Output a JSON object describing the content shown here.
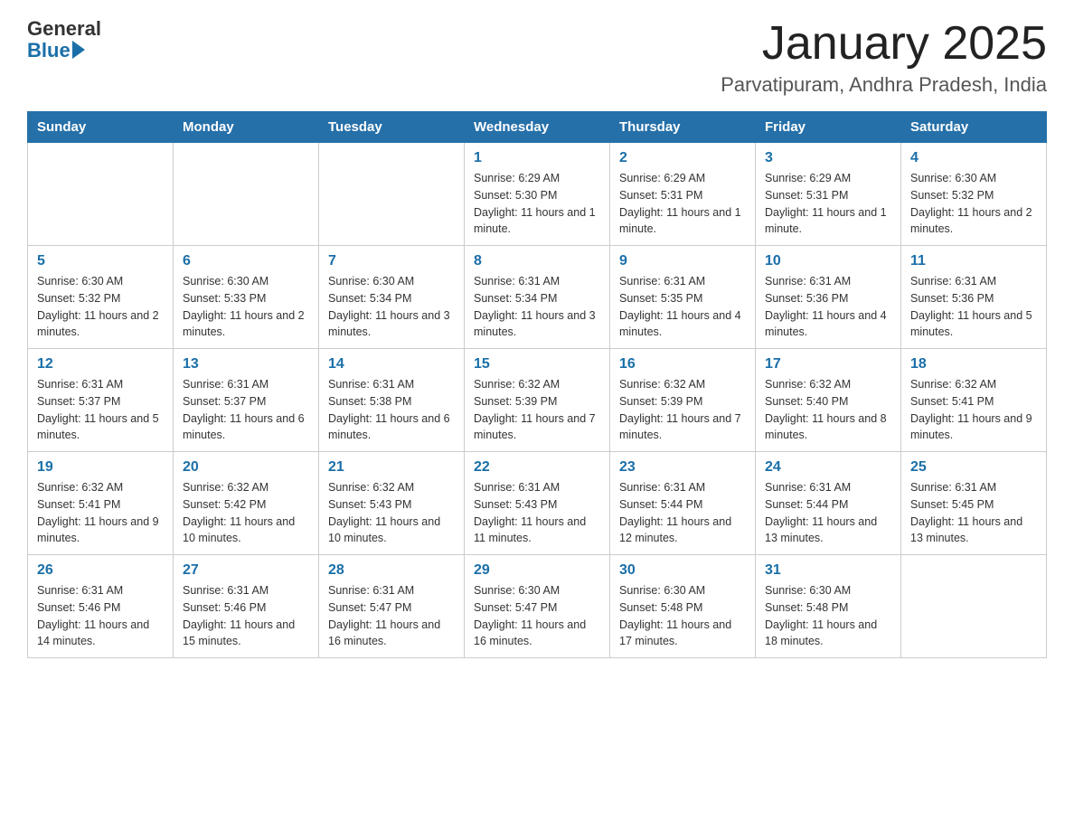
{
  "header": {
    "logo_general": "General",
    "logo_blue": "Blue",
    "month_year": "January 2025",
    "location": "Parvatipuram, Andhra Pradesh, India"
  },
  "weekdays": [
    "Sunday",
    "Monday",
    "Tuesday",
    "Wednesday",
    "Thursday",
    "Friday",
    "Saturday"
  ],
  "weeks": [
    [
      {
        "day": "",
        "info": ""
      },
      {
        "day": "",
        "info": ""
      },
      {
        "day": "",
        "info": ""
      },
      {
        "day": "1",
        "info": "Sunrise: 6:29 AM\nSunset: 5:30 PM\nDaylight: 11 hours and 1 minute."
      },
      {
        "day": "2",
        "info": "Sunrise: 6:29 AM\nSunset: 5:31 PM\nDaylight: 11 hours and 1 minute."
      },
      {
        "day": "3",
        "info": "Sunrise: 6:29 AM\nSunset: 5:31 PM\nDaylight: 11 hours and 1 minute."
      },
      {
        "day": "4",
        "info": "Sunrise: 6:30 AM\nSunset: 5:32 PM\nDaylight: 11 hours and 2 minutes."
      }
    ],
    [
      {
        "day": "5",
        "info": "Sunrise: 6:30 AM\nSunset: 5:32 PM\nDaylight: 11 hours and 2 minutes."
      },
      {
        "day": "6",
        "info": "Sunrise: 6:30 AM\nSunset: 5:33 PM\nDaylight: 11 hours and 2 minutes."
      },
      {
        "day": "7",
        "info": "Sunrise: 6:30 AM\nSunset: 5:34 PM\nDaylight: 11 hours and 3 minutes."
      },
      {
        "day": "8",
        "info": "Sunrise: 6:31 AM\nSunset: 5:34 PM\nDaylight: 11 hours and 3 minutes."
      },
      {
        "day": "9",
        "info": "Sunrise: 6:31 AM\nSunset: 5:35 PM\nDaylight: 11 hours and 4 minutes."
      },
      {
        "day": "10",
        "info": "Sunrise: 6:31 AM\nSunset: 5:36 PM\nDaylight: 11 hours and 4 minutes."
      },
      {
        "day": "11",
        "info": "Sunrise: 6:31 AM\nSunset: 5:36 PM\nDaylight: 11 hours and 5 minutes."
      }
    ],
    [
      {
        "day": "12",
        "info": "Sunrise: 6:31 AM\nSunset: 5:37 PM\nDaylight: 11 hours and 5 minutes."
      },
      {
        "day": "13",
        "info": "Sunrise: 6:31 AM\nSunset: 5:37 PM\nDaylight: 11 hours and 6 minutes."
      },
      {
        "day": "14",
        "info": "Sunrise: 6:31 AM\nSunset: 5:38 PM\nDaylight: 11 hours and 6 minutes."
      },
      {
        "day": "15",
        "info": "Sunrise: 6:32 AM\nSunset: 5:39 PM\nDaylight: 11 hours and 7 minutes."
      },
      {
        "day": "16",
        "info": "Sunrise: 6:32 AM\nSunset: 5:39 PM\nDaylight: 11 hours and 7 minutes."
      },
      {
        "day": "17",
        "info": "Sunrise: 6:32 AM\nSunset: 5:40 PM\nDaylight: 11 hours and 8 minutes."
      },
      {
        "day": "18",
        "info": "Sunrise: 6:32 AM\nSunset: 5:41 PM\nDaylight: 11 hours and 9 minutes."
      }
    ],
    [
      {
        "day": "19",
        "info": "Sunrise: 6:32 AM\nSunset: 5:41 PM\nDaylight: 11 hours and 9 minutes."
      },
      {
        "day": "20",
        "info": "Sunrise: 6:32 AM\nSunset: 5:42 PM\nDaylight: 11 hours and 10 minutes."
      },
      {
        "day": "21",
        "info": "Sunrise: 6:32 AM\nSunset: 5:43 PM\nDaylight: 11 hours and 10 minutes."
      },
      {
        "day": "22",
        "info": "Sunrise: 6:31 AM\nSunset: 5:43 PM\nDaylight: 11 hours and 11 minutes."
      },
      {
        "day": "23",
        "info": "Sunrise: 6:31 AM\nSunset: 5:44 PM\nDaylight: 11 hours and 12 minutes."
      },
      {
        "day": "24",
        "info": "Sunrise: 6:31 AM\nSunset: 5:44 PM\nDaylight: 11 hours and 13 minutes."
      },
      {
        "day": "25",
        "info": "Sunrise: 6:31 AM\nSunset: 5:45 PM\nDaylight: 11 hours and 13 minutes."
      }
    ],
    [
      {
        "day": "26",
        "info": "Sunrise: 6:31 AM\nSunset: 5:46 PM\nDaylight: 11 hours and 14 minutes."
      },
      {
        "day": "27",
        "info": "Sunrise: 6:31 AM\nSunset: 5:46 PM\nDaylight: 11 hours and 15 minutes."
      },
      {
        "day": "28",
        "info": "Sunrise: 6:31 AM\nSunset: 5:47 PM\nDaylight: 11 hours and 16 minutes."
      },
      {
        "day": "29",
        "info": "Sunrise: 6:30 AM\nSunset: 5:47 PM\nDaylight: 11 hours and 16 minutes."
      },
      {
        "day": "30",
        "info": "Sunrise: 6:30 AM\nSunset: 5:48 PM\nDaylight: 11 hours and 17 minutes."
      },
      {
        "day": "31",
        "info": "Sunrise: 6:30 AM\nSunset: 5:48 PM\nDaylight: 11 hours and 18 minutes."
      },
      {
        "day": "",
        "info": ""
      }
    ]
  ]
}
